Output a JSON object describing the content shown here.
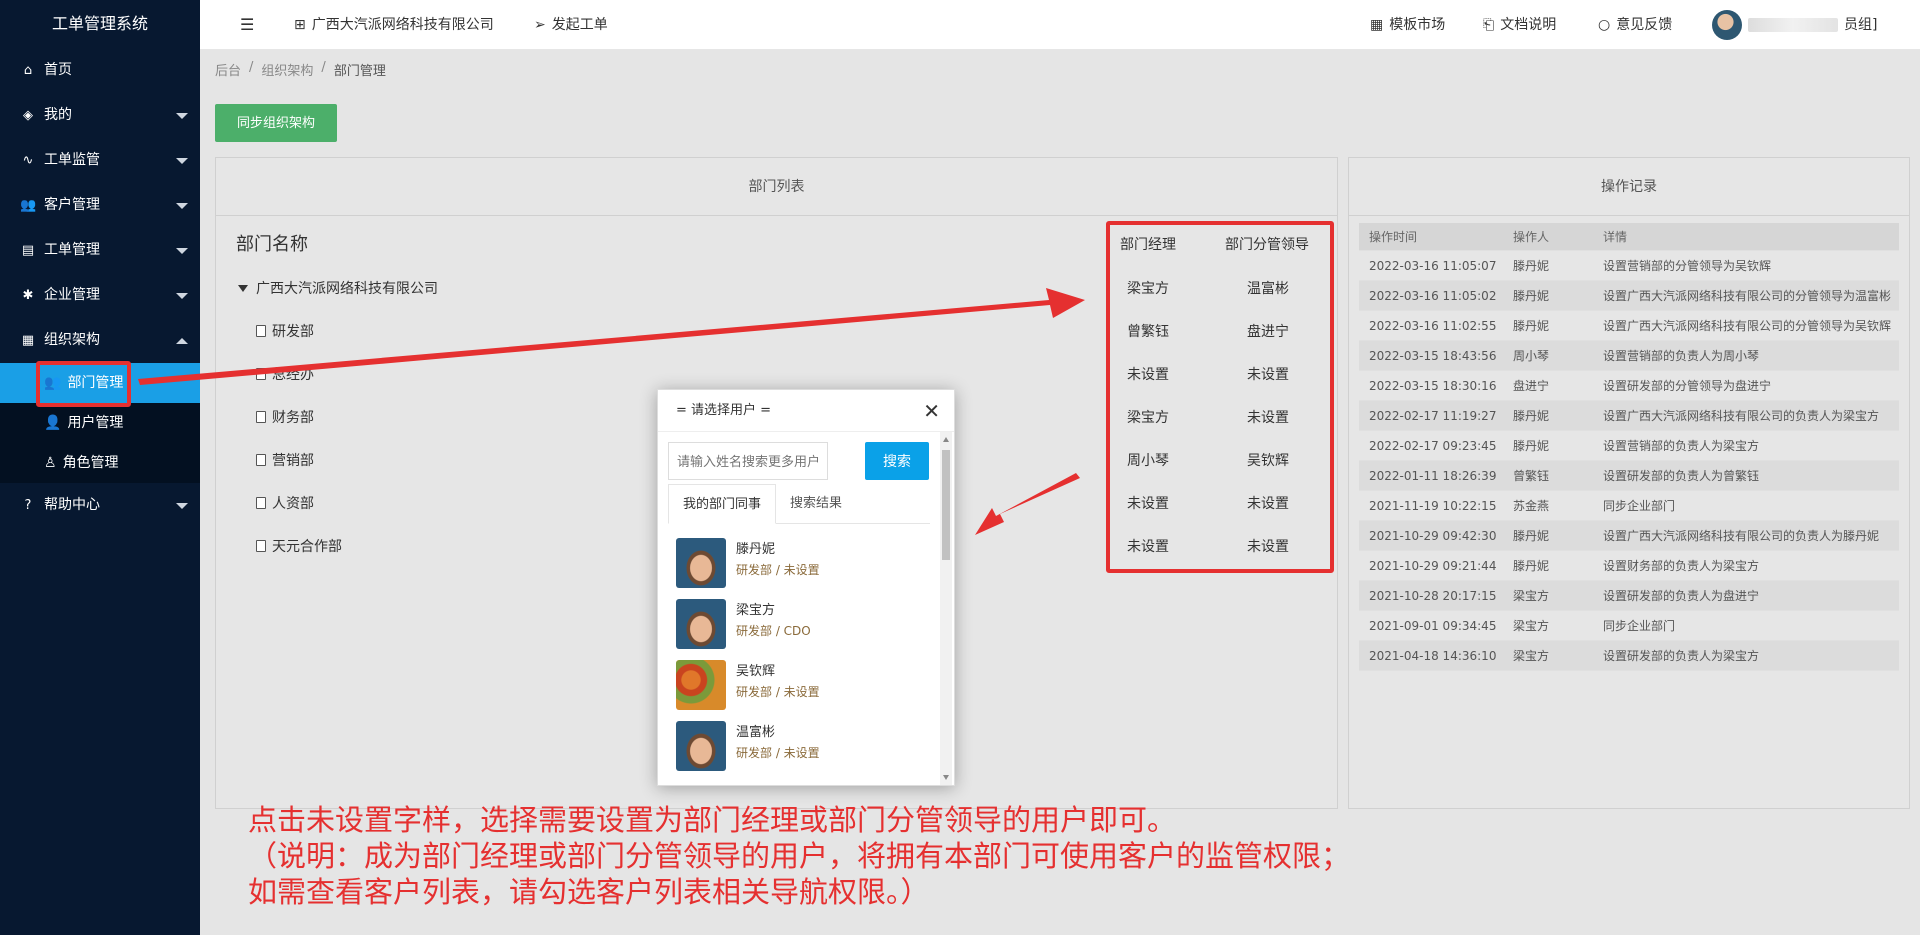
{
  "sidebar": {
    "brand": "工单管理系统",
    "items": [
      {
        "label": "首页",
        "icon": "home-icon",
        "glyph": "⌂",
        "has_caret": false
      },
      {
        "label": "我的",
        "icon": "layers-icon",
        "glyph": "◈",
        "has_caret": true
      },
      {
        "label": "工单监管",
        "icon": "pulse-icon",
        "glyph": "∿",
        "has_caret": true
      },
      {
        "label": "客户管理",
        "icon": "users-icon",
        "glyph": "👥",
        "has_caret": true
      },
      {
        "label": "工单管理",
        "icon": "clipboard-icon",
        "glyph": "▤",
        "has_caret": true
      },
      {
        "label": "企业管理",
        "icon": "gear-icon",
        "glyph": "✱",
        "has_caret": true
      },
      {
        "label": "组织架构",
        "icon": "calendar-icon",
        "glyph": "▦",
        "has_caret": true
      }
    ],
    "sub_items": [
      {
        "label": "部门管理",
        "icon": "group-icon",
        "glyph": "👥"
      },
      {
        "label": "用户管理",
        "icon": "user-icon",
        "glyph": "👤"
      },
      {
        "label": "角色管理",
        "icon": "user-outline-icon",
        "glyph": "♙"
      }
    ],
    "help": {
      "label": "帮助中心",
      "glyph": "?"
    }
  },
  "topbar": {
    "menu_glyph": "☰",
    "company": "广西大汽派网络科技有限公司",
    "create": "发起工单",
    "market": "模板市场",
    "docs": "文档说明",
    "feedback": "意见反馈",
    "user_suffix": "员组]"
  },
  "breadcrumb": {
    "root": "后台",
    "sep": "/",
    "mid": "组织架构",
    "current": "部门管理"
  },
  "sync_button": "同步组织架构",
  "dept_panel": {
    "title": "部门列表",
    "name_header": "部门名称",
    "manager_header": "部门经理",
    "leader_header": "部门分管领导",
    "root": "广西大汽派网络科技有限公司",
    "rows": [
      {
        "name": "",
        "manager": "梁宝方",
        "leader": "温富彬"
      },
      {
        "name": "研发部",
        "manager": "曾繁钰",
        "leader": "盘进宁"
      },
      {
        "name": "总经办",
        "manager": "未设置",
        "leader": "未设置"
      },
      {
        "name": "财务部",
        "manager": "梁宝方",
        "leader": "未设置"
      },
      {
        "name": "营销部",
        "manager": "周小琴",
        "leader": "吴钦辉"
      },
      {
        "name": "人资部",
        "manager": "未设置",
        "leader": "未设置"
      },
      {
        "name": "天元合作部",
        "manager": "未设置",
        "leader": "未设置"
      }
    ]
  },
  "ops_panel": {
    "title": "操作记录",
    "headers": [
      "操作时间",
      "操作人",
      "详情"
    ],
    "rows": [
      [
        "2022-03-16 11:05:07",
        "滕丹妮",
        "设置营销部的分管领导为吴钦辉"
      ],
      [
        "2022-03-16 11:05:02",
        "滕丹妮",
        "设置广西大汽派网络科技有限公司的分管领导为温富彬"
      ],
      [
        "2022-03-16 11:02:55",
        "滕丹妮",
        "设置广西大汽派网络科技有限公司的分管领导为吴钦辉"
      ],
      [
        "2022-03-15 18:43:56",
        "周小琴",
        "设置营销部的负责人为周小琴"
      ],
      [
        "2022-03-15 18:30:16",
        "盘进宁",
        "设置研发部的分管领导为盘进宁"
      ],
      [
        "2022-02-17 11:19:27",
        "滕丹妮",
        "设置广西大汽派网络科技有限公司的负责人为梁宝方"
      ],
      [
        "2022-02-17 09:23:45",
        "滕丹妮",
        "设置营销部的负责人为梁宝方"
      ],
      [
        "2022-01-11 18:26:39",
        "曾繁钰",
        "设置研发部的负责人为曾繁钰"
      ],
      [
        "2021-11-19 10:22:15",
        "苏金燕",
        "同步企业部门"
      ],
      [
        "2021-10-29 09:42:30",
        "滕丹妮",
        "设置广西大汽派网络科技有限公司的负责人为滕丹妮"
      ],
      [
        "2021-10-29 09:21:44",
        "滕丹妮",
        "设置财务部的负责人为梁宝方"
      ],
      [
        "2021-10-28 20:17:15",
        "梁宝方",
        "设置研发部的负责人为盘进宁"
      ],
      [
        "2021-09-01 09:34:45",
        "梁宝方",
        "同步企业部门"
      ],
      [
        "2021-04-18 14:36:10",
        "梁宝方",
        "设置研发部的负责人为梁宝方"
      ]
    ]
  },
  "modal": {
    "title": "= 请选择用户 =",
    "close": "✕",
    "search_placeholder": "请输入姓名搜索更多用户",
    "search_button": "搜索",
    "tabs": [
      "我的部门同事",
      "搜索结果"
    ],
    "users": [
      {
        "name": "滕丹妮",
        "dept": "研发部 / 未设置",
        "avatar": "kid"
      },
      {
        "name": "梁宝方",
        "dept": "研发部 / CDO",
        "avatar": "kid"
      },
      {
        "name": "吴钦辉",
        "dept": "研发部 / 未设置",
        "avatar": "food"
      },
      {
        "name": "温富彬",
        "dept": "研发部 / 未设置",
        "avatar": "kid"
      }
    ]
  },
  "annotation": {
    "line1": "点击未设置字样，选择需要设置为部门经理或部门分管领导的用户即可。",
    "line2": "（说明：成为部门经理或部门分管领导的用户，将拥有本部门可使用客户的监管权限；",
    "line3": "如需查看客户列表，请勾选客户列表相关导航权限。）"
  },
  "colors": {
    "sidebar": "#071830",
    "active": "#1a9fe6",
    "accent_red": "#e53030",
    "sync_green": "#4caf6a",
    "search_blue": "#0aa1e8"
  }
}
